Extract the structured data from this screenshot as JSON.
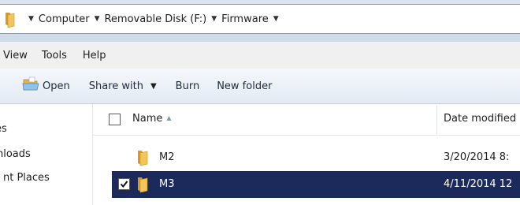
{
  "address_bar": {
    "icon": "folder-icon",
    "crumbs": [
      "Computer",
      "Removable Disk (F:)",
      "Firmware"
    ]
  },
  "menu": {
    "items": [
      "View",
      "Tools",
      "Help"
    ]
  },
  "commands": {
    "open_label": "Open",
    "share_label": "Share with",
    "burn_label": "Burn",
    "new_folder_label": "New folder"
  },
  "nav": {
    "items": [
      "es",
      "nloads",
      "nt Places"
    ]
  },
  "columns": {
    "name": "Name",
    "date_modified": "Date modified"
  },
  "files": [
    {
      "name": "M2",
      "date": "3/20/2014 8:",
      "selected": false,
      "checked": false,
      "icon": "folder-icon"
    },
    {
      "name": "M3",
      "date": "4/11/2014 12",
      "selected": true,
      "checked": true,
      "icon": "folder-icon"
    }
  ],
  "colors": {
    "selection": "#1b2a5a",
    "folder": "#e8b84a"
  }
}
